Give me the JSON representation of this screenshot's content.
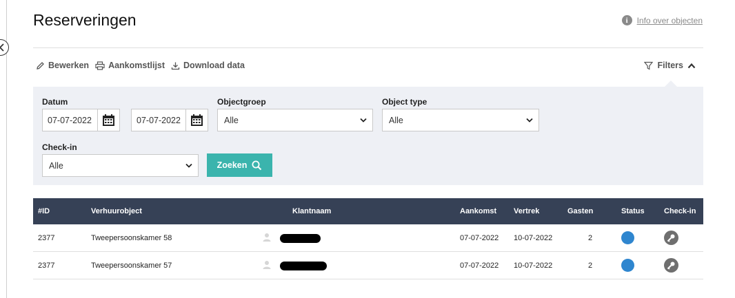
{
  "page": {
    "title": "Reserveringen",
    "info_link": "Info over objecten"
  },
  "toolbar": {
    "edit": "Bewerken",
    "arrivals": "Aankomstlijst",
    "download": "Download data",
    "filters": "Filters"
  },
  "filters": {
    "date_label": "Datum",
    "date_from": "07-07-2022",
    "date_to": "07-07-2022",
    "objectgroup_label": "Objectgroep",
    "objectgroup_value": "Alle",
    "objecttype_label": "Object type",
    "objecttype_value": "Alle",
    "checkin_label": "Check-in",
    "checkin_value": "Alle",
    "search_button": "Zoeken"
  },
  "table": {
    "headers": {
      "id": "#ID",
      "object": "Verhuurobject",
      "customer": "Klantnaam",
      "arrival": "Aankomst",
      "departure": "Vertrek",
      "guests": "Gasten",
      "status": "Status",
      "checkin": "Check-in"
    },
    "rows": [
      {
        "id": "2377",
        "object": "Tweepersoonskamer 58",
        "arrival": "07-07-2022",
        "departure": "10-07-2022",
        "guests": "2"
      },
      {
        "id": "2377",
        "object": "Tweepersoonskamer 57",
        "arrival": "07-07-2022",
        "departure": "10-07-2022",
        "guests": "2"
      }
    ]
  },
  "colors": {
    "header_bg": "#364156",
    "accent": "#3bb4ad",
    "status_blue": "#2f86cf",
    "panel_bg": "#eef0f5"
  },
  "icons": [
    "collapse-left-icon",
    "info-icon",
    "pencil-icon",
    "printer-icon",
    "download-icon",
    "filter-icon",
    "chevron-up-icon",
    "calendar-icon",
    "chevron-down-icon",
    "search-icon",
    "person-icon",
    "key-icon"
  ]
}
